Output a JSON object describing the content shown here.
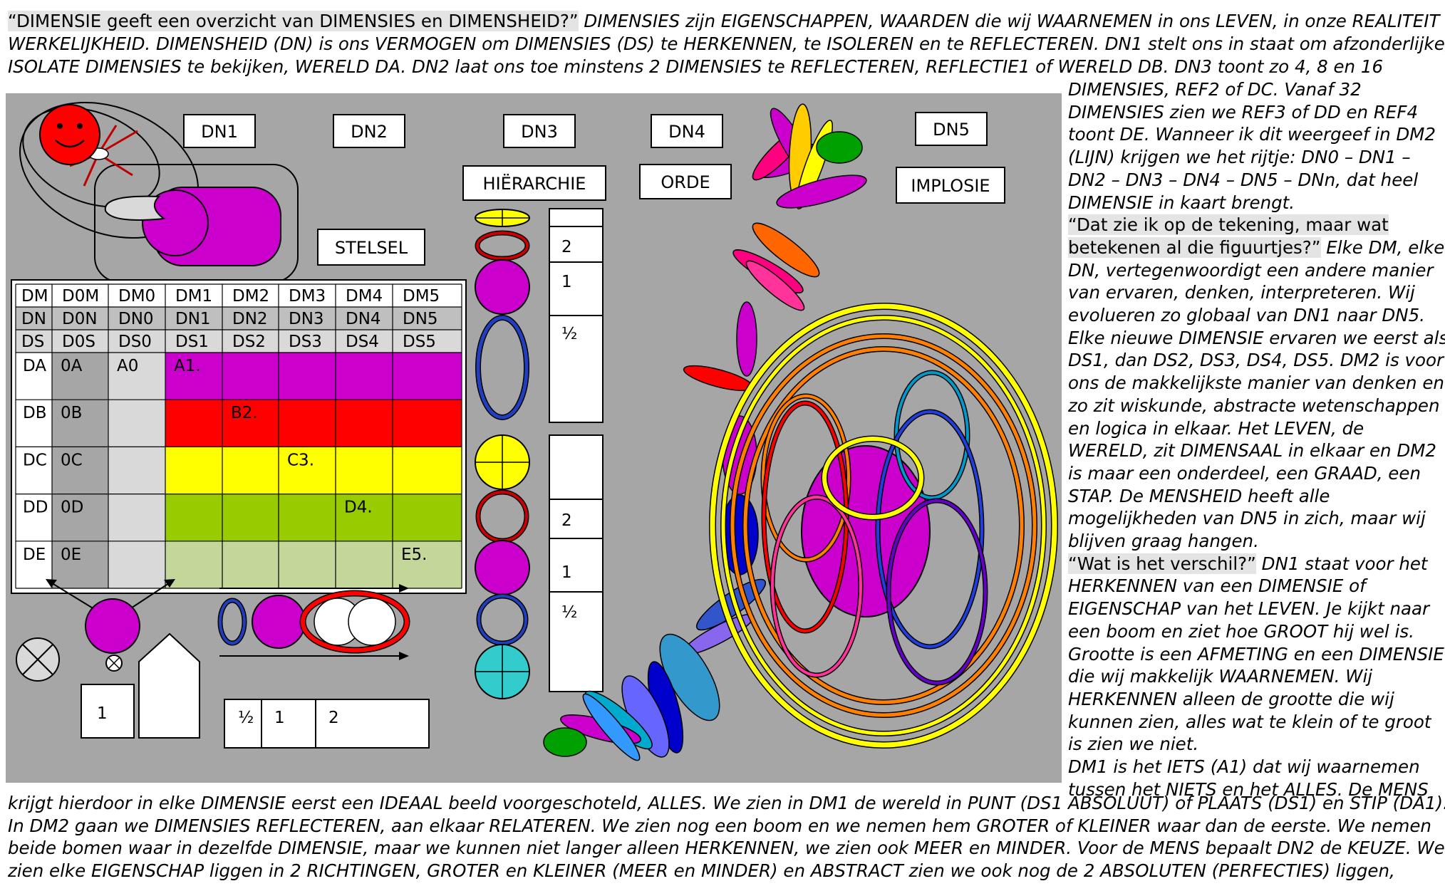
{
  "text_top": {
    "quote": "“DIMENSIE geeft een overzicht van DIMENSIES en DIMENSHEID?”",
    "line1_rest": " DIMENSIES zijn EIGENSCHAPPEN, WAARDEN die wij WAARNEMEN in ons LEVEN, in onze REALITEIT of",
    "line2": "WERKELIJKHEID. DIMENSHEID (DN) is ons VERMOGEN om DIMENSIES (DS) te HERKENNEN, te ISOLEREN en te REFLECTEREN. DN1 stelt ons in staat om afzonderlijke,",
    "line3": "ISOLATE DIMENSIES te bekijken, WERELD DA. DN2 laat ons toe minstens 2 DIMENSIES te REFLECTEREN, REFLECTIE1 of WERELD DB. DN3 toont zo 4, 8 en 16"
  },
  "text_right": [
    {
      "text": "DIMENSIES, REF2 of DC. Vanaf 32"
    },
    {
      "text": "DIMENSIES zien we REF3 of DD en REF4"
    },
    {
      "text": "toont DE. Wanneer ik dit weergeef in DM2"
    },
    {
      "text": "(LIJN) krijgen we het rijtje: DN0 – DN1 –"
    },
    {
      "text": "DN2 – DN3 – DN4 – DN5 – DNn, dat heel"
    },
    {
      "text": "DIMENSIE in kaart brengt."
    },
    {
      "quote": "“Dat zie ik op de tekening, maar wat"
    },
    {
      "quote": "betekenen al die figuurtjes?”",
      "text": " Elke DM, elke"
    },
    {
      "text": "DN, vertegenwoordigt een andere manier"
    },
    {
      "text": "van ervaren, denken, interpreteren. Wij"
    },
    {
      "text": "evolueren zo globaal van DN1 naar DN5."
    },
    {
      "text": "Elke nieuwe DIMENSIE ervaren we eerst als"
    },
    {
      "text": "DS1, dan DS2, DS3, DS4, DS5. DM2 is voor"
    },
    {
      "text": "ons de makkelijkste manier van denken en"
    },
    {
      "text": "zo zit wiskunde, abstracte wetenschappen"
    },
    {
      "text": "en logica in elkaar. Het LEVEN, de"
    },
    {
      "text": "WERELD, zit DIMENSAAL in elkaar en DM2"
    },
    {
      "text": "is maar een onderdeel, een GRAAD, een"
    },
    {
      "text": "STAP. De MENSHEID heeft alle"
    },
    {
      "text": "mogelijkheden van DN5 in zich, maar wij"
    },
    {
      "text": "blijven graag hangen."
    },
    {
      "quote": "“Wat is het verschil?”",
      "text": " DN1 staat voor het"
    },
    {
      "text": "HERKENNEN van een DIMENSIE of"
    },
    {
      "text": "EIGENSCHAP van het LEVEN. Je kijkt naar"
    },
    {
      "text": "een boom en ziet hoe GROOT hij wel is."
    },
    {
      "text": "Grootte is een AFMETING en een DIMENSIE"
    },
    {
      "text": "die wij makkelijk WAARNEMEN. Wij"
    },
    {
      "text": "HERKENNEN alleen de grootte die wij"
    },
    {
      "text": "kunnen zien, alles wat te klein of te groot"
    },
    {
      "text": "is zien we niet."
    },
    {
      "text": "DM1 is het IETS (A1) dat wij waarnemen"
    },
    {
      "text": "tussen het NIETS en het ALLES. De MENS"
    }
  ],
  "text_bottom": [
    "krijgt hierdoor in elke DIMENSIE eerst een IDEAAL beeld voorgeschoteld, ALLES. We zien in DM1 de wereld in PUNT (DS1 ABSOLUUT) of PLAATS (DS1) en STIP (DA1).",
    "In DM2 gaan we DIMENSIES REFLECTEREN, aan elkaar RELATEREN. We zien nog een boom en we nemen hem GROTER of KLEINER waar dan de eerste. We nemen",
    "beide bomen waar in dezelfde DIMENSIE, maar we kunnen niet langer alleen HERKENNEN, we zien ook MEER en MINDER. Voor de MENS bepaalt DN2 de KEUZE. We",
    "zien elke EIGENSCHAP liggen in 2 RICHTINGEN, GROTER en KLEINER (MEER en MINDER) en ABSTRACT zien we ook nog de 2 ABSOLUTEN (PERFECTIES) liggen,"
  ],
  "diagram": {
    "labels": {
      "dn1": "DN1",
      "dn2": "DN2",
      "dn3": "DN3",
      "dn4": "DN4",
      "dn5": "DN5",
      "stelsel": "STELSEL",
      "hierarchie": "HIËRARCHIE",
      "orde": "ORDE",
      "implosie": "IMPLOSIE"
    },
    "table": {
      "header_rows": [
        [
          "DM",
          "D0M",
          "DM0",
          "DM1",
          "DM2",
          "DM3",
          "DM4",
          "DM5"
        ],
        [
          "DN",
          "D0N",
          "DN0",
          "DN1",
          "DN2",
          "DN3",
          "DN4",
          "DN5"
        ],
        [
          "DS",
          "D0S",
          "DS0",
          "DS1",
          "DS2",
          "DS3",
          "DS4",
          "DS5"
        ]
      ],
      "body_rows": [
        {
          "label": "DA",
          "c0": "0A",
          "c1": "A0",
          "mark": "A1.",
          "mark_col": 0,
          "color": "#cc00cc"
        },
        {
          "label": "DB",
          "c0": "0B",
          "c1": "",
          "mark": "B2.",
          "mark_col": 1,
          "color": "#ff0000"
        },
        {
          "label": "DC",
          "c0": "0C",
          "c1": "",
          "mark": "C3.",
          "mark_col": 2,
          "color": "#ffff00"
        },
        {
          "label": "DD",
          "c0": "0D",
          "c1": "",
          "mark": "D4.",
          "mark_col": 3,
          "color": "#99cc00"
        },
        {
          "label": "DE",
          "c0": "0E",
          "c1": "",
          "mark": "E5.",
          "mark_col": 4,
          "color": "#c4d79b"
        }
      ]
    },
    "bars_top": [
      "2",
      "1",
      "½"
    ],
    "bars_bottom": [
      "2",
      "1",
      "½"
    ],
    "small_box": "1",
    "bottom_boxes": [
      "½",
      "1",
      "2"
    ]
  }
}
